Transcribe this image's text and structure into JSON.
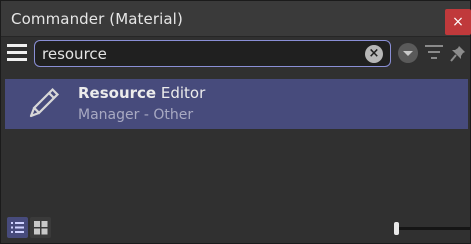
{
  "window": {
    "title": "Commander (Material)",
    "close_glyph": "×"
  },
  "toolbar": {
    "menu_icon": "hamburger-menu-icon",
    "search": {
      "value": "resource",
      "placeholder": ""
    },
    "clear_icon": "clear-search-icon",
    "dropdown_icon": "dropdown-arrow-icon",
    "filter_icon": "filter-icon",
    "pin_icon": "pin-icon"
  },
  "results": [
    {
      "icon": "pencil-icon",
      "title_match": "Resource",
      "title_rest": " Editor",
      "subtitle": "Manager - Other",
      "selected": true
    }
  ],
  "footer": {
    "view_modes": [
      "list-view-icon",
      "grid-view-icon"
    ],
    "active_view": "list",
    "zoom_level": 0.04
  },
  "colors": {
    "background": "#303030",
    "accent": "#474b7c",
    "search_border": "#8a8fd6",
    "close": "#c0393b"
  }
}
